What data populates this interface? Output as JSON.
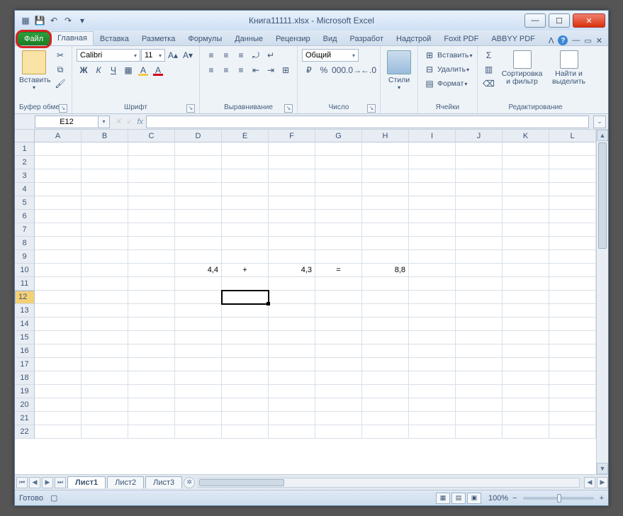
{
  "title": {
    "doc": "Книга11111.xlsx",
    "sep": " - ",
    "app": "Microsoft Excel"
  },
  "tabs": {
    "file": "Файл",
    "items": [
      "Главная",
      "Вставка",
      "Разметка",
      "Формулы",
      "Данные",
      "Рецензир",
      "Вид",
      "Разработ",
      "Надстрой",
      "Foxit PDF",
      "ABBYY PDF"
    ],
    "active_index": 0
  },
  "ribbon": {
    "clipboard": {
      "group": "Буфер обмена",
      "paste": "Вставить"
    },
    "font": {
      "group": "Шрифт",
      "name": "Calibri",
      "size": "11",
      "bold": "Ж",
      "italic": "К",
      "underline": "Ч"
    },
    "alignment": {
      "group": "Выравнивание"
    },
    "number": {
      "group": "Число",
      "format": "Общий"
    },
    "styles": {
      "group": "Стили",
      "btn": "Стили"
    },
    "cells": {
      "group": "Ячейки",
      "insert": "Вставить",
      "delete": "Удалить",
      "format": "Формат"
    },
    "editing": {
      "group": "Редактирование",
      "sort": "Сортировка и фильтр",
      "find": "Найти и выделить"
    }
  },
  "formula_bar": {
    "name_box": "E12",
    "fx": "fx",
    "formula": ""
  },
  "grid": {
    "columns": [
      "A",
      "B",
      "C",
      "D",
      "E",
      "F",
      "G",
      "H",
      "I",
      "J",
      "K",
      "L"
    ],
    "rows": 22,
    "selected_cell": "E12",
    "selected_row": 12,
    "data": {
      "D10": "4,4",
      "E10": "+",
      "F10": "4,3",
      "G10": "=",
      "H10": "8,8"
    }
  },
  "sheets": {
    "items": [
      "Лист1",
      "Лист2",
      "Лист3"
    ],
    "active_index": 0
  },
  "status": {
    "text": "Готово",
    "zoom": "100%",
    "minus": "−",
    "plus": "+"
  }
}
